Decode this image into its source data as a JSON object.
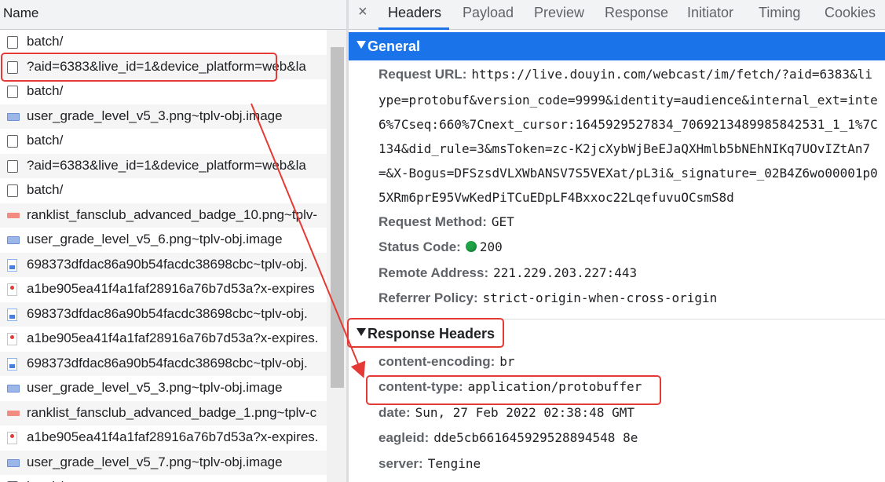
{
  "network_list": {
    "header": "Name",
    "items": [
      {
        "icon": "document-icon",
        "name": "batch/"
      },
      {
        "icon": "document-icon",
        "name": "?aid=6383&live_id=1&device_platform=web&la"
      },
      {
        "icon": "document-icon",
        "name": "batch/"
      },
      {
        "icon": "image-icon",
        "name": "user_grade_level_v5_3.png~tplv-obj.image"
      },
      {
        "icon": "document-icon",
        "name": "batch/"
      },
      {
        "icon": "document-icon",
        "name": "?aid=6383&live_id=1&device_platform=web&la"
      },
      {
        "icon": "document-icon",
        "name": "batch/"
      },
      {
        "icon": "badge-image-icon",
        "name": "ranklist_fansclub_advanced_badge_10.png~tplv-"
      },
      {
        "icon": "image-icon",
        "name": "user_grade_level_v5_6.png~tplv-obj.image"
      },
      {
        "icon": "picture-file-icon",
        "name": "698373dfdac86a90b54facdc38698cbc~tplv-obj."
      },
      {
        "icon": "pin-file-icon",
        "name": "a1be905ea41f4a1faf28916a76b7d53a?x-expires"
      },
      {
        "icon": "picture-file-icon",
        "name": "698373dfdac86a90b54facdc38698cbc~tplv-obj."
      },
      {
        "icon": "pin-file-icon",
        "name": "a1be905ea41f4a1faf28916a76b7d53a?x-expires."
      },
      {
        "icon": "picture-file-icon",
        "name": "698373dfdac86a90b54facdc38698cbc~tplv-obj."
      },
      {
        "icon": "image-icon",
        "name": "user_grade_level_v5_3.png~tplv-obj.image"
      },
      {
        "icon": "badge-image-icon",
        "name": "ranklist_fansclub_advanced_badge_1.png~tplv-c"
      },
      {
        "icon": "pin-file-icon",
        "name": "a1be905ea41f4a1faf28916a76b7d53a?x-expires."
      },
      {
        "icon": "image-icon",
        "name": "user_grade_level_v5_7.png~tplv-obj.image"
      },
      {
        "icon": "document-icon",
        "name": "batch/"
      }
    ]
  },
  "tabs": {
    "close": "×",
    "items": [
      "Headers",
      "Payload",
      "Preview",
      "Response",
      "Initiator",
      "Timing",
      "Cookies"
    ],
    "active": "Headers"
  },
  "general": {
    "title": "General",
    "request_url_key": "Request URL:",
    "request_url_lines": [
      "https://live.douyin.com/webcast/im/fetch/?aid=6383&li",
      "ype=protobuf&version_code=9999&identity=audience&internal_ext=inte",
      "6%7Cseq:660%7Cnext_cursor:1645929527834_7069213489985842531_1_1%7C",
      "134&did_rule=3&msToken=zc-K2jcXybWjBeEJaQXHmlb5bNEhNIKq7UOvIZtAn7",
      "=&X-Bogus=DFSzsdVLXWbANSV7S5VEXat/pL3i&_signature=_02B4Z6wo00001p0",
      "5XRm6prE95VwKedPiTCuEDpLF4Bxxoc22LqefuvuOCsmS8d"
    ],
    "request_method_key": "Request Method:",
    "request_method": "GET",
    "status_code_key": "Status Code:",
    "status_code": "200",
    "status_color": "#1ea446",
    "remote_address_key": "Remote Address:",
    "remote_address": "221.229.203.227:443",
    "referrer_policy_key": "Referrer Policy:",
    "referrer_policy": "strict-origin-when-cross-origin"
  },
  "response_headers": {
    "title": "Response Headers",
    "content_encoding_key": "content-encoding:",
    "content_encoding": "br",
    "content_type_key": "content-type:",
    "content_type": "application/protobuffer",
    "date_key": "date:",
    "date": "Sun, 27 Feb 2022 02:38:48 GMT",
    "eagleid_key": "eagleid:",
    "eagleid": "dde5cb661645929528894548 8e",
    "server_key": "server:",
    "server": "Tengine"
  },
  "colors": {
    "accent": "#1a73e8",
    "annotation": "#e53935"
  }
}
